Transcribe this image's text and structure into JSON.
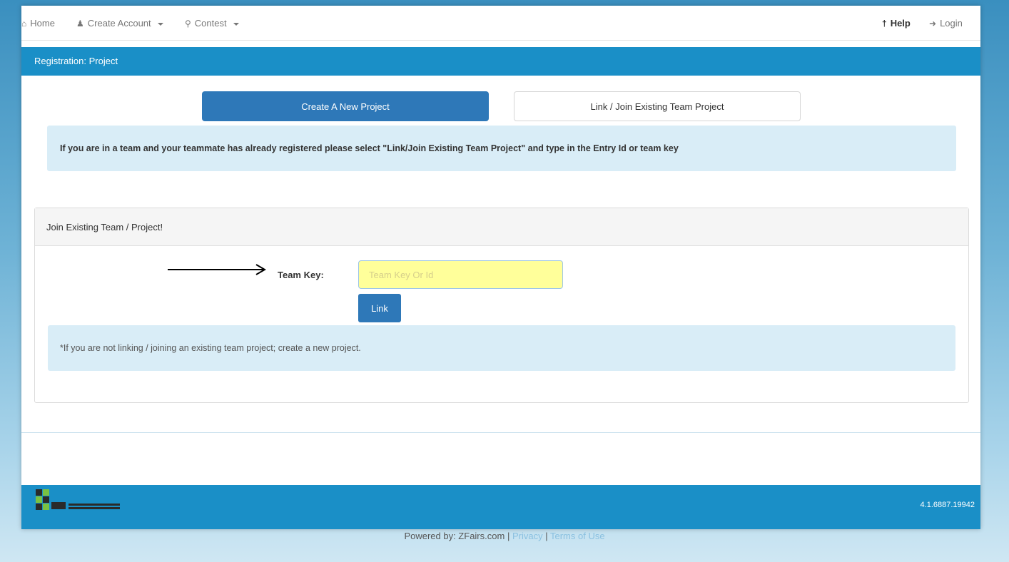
{
  "nav": {
    "home": "Home",
    "create_account": "Create Account",
    "contest": "Contest",
    "help": "Help",
    "login": "Login"
  },
  "header": {
    "title": "Registration: Project"
  },
  "tabs": {
    "create": "Create A New Project",
    "link": "Link / Join Existing Team Project"
  },
  "alert_top": "If you are in a team and your teammate has already registered please select \"Link/Join Existing Team Project\" and type in the Entry Id or team key",
  "panel": {
    "heading": "Join Existing Team / Project!",
    "team_key_label": "Team Key:",
    "team_key_placeholder": "Team Key Or Id",
    "link_button": "Link",
    "note": "*If you are not linking / joining an existing team project; create a new project."
  },
  "footer": {
    "version": "4.1.6887.19942",
    "powered_by": "Powered by: ZFairs.com",
    "separator": "|",
    "privacy": "Privacy",
    "terms": "Terms of Use"
  },
  "colors": {
    "brand_blue": "#1a8fc7",
    "button_blue": "#2e78b8",
    "alert_bg": "#d9edf7",
    "input_highlight": "#ffff9a"
  }
}
